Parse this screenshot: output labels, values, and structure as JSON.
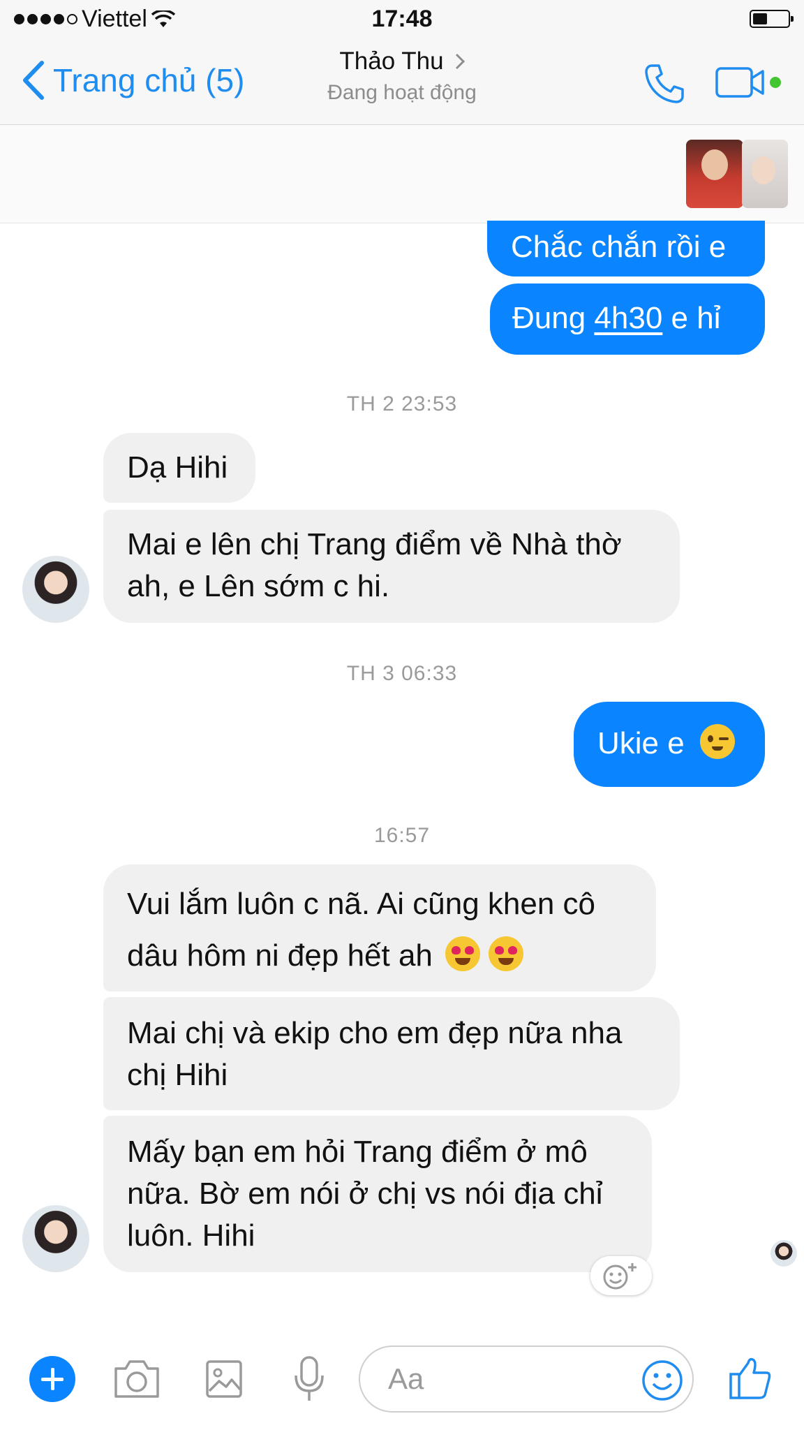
{
  "status_bar": {
    "carrier": "Viettel",
    "time": "17:48"
  },
  "nav": {
    "back_label": "Trang chủ (5)",
    "contact_name": "Thảo Thu",
    "contact_status": "Đang hoạt động"
  },
  "messages": [
    {
      "type": "outgoing",
      "text": "Chắc chắn rồi e"
    },
    {
      "type": "outgoing",
      "text_before": "Đung ",
      "link": "4h30",
      "text_after": " e hỉ"
    },
    {
      "type": "timestamp",
      "text": "TH 2 23:53"
    },
    {
      "type": "incoming",
      "text": "Dạ Hihi"
    },
    {
      "type": "incoming",
      "lines": [
        "Mai e lên chị Trang điểm về Nhà thờ",
        "ah, e Lên sớm c hi."
      ]
    },
    {
      "type": "timestamp",
      "text": "TH 3 06:33"
    },
    {
      "type": "outgoing",
      "text": "Ukie e",
      "emoji": "wink-emoji"
    },
    {
      "type": "timestamp",
      "text": "16:57"
    },
    {
      "type": "incoming",
      "lines": [
        "Vui lắm luôn c nã. Ai cũng khen cô",
        "dâu hôm ni đẹp hết ah"
      ],
      "emoji": "heart-eyes-emoji x2"
    },
    {
      "type": "incoming",
      "lines": [
        "Mai chị và ekip cho em đẹp nữa nha",
        "chị Hihi"
      ]
    },
    {
      "type": "incoming",
      "lines": [
        "Mấy bạn em hỏi Trang điểm ở mô",
        "nữa. Bờ em nói ở chị vs nói địa chỉ",
        "luôn. Hihi"
      ]
    }
  ],
  "composer": {
    "placeholder": "Aa"
  },
  "colors": {
    "accent": "#0a84ff",
    "incoming_bubble": "#f0f0f0",
    "online_dot": "#42c531"
  }
}
